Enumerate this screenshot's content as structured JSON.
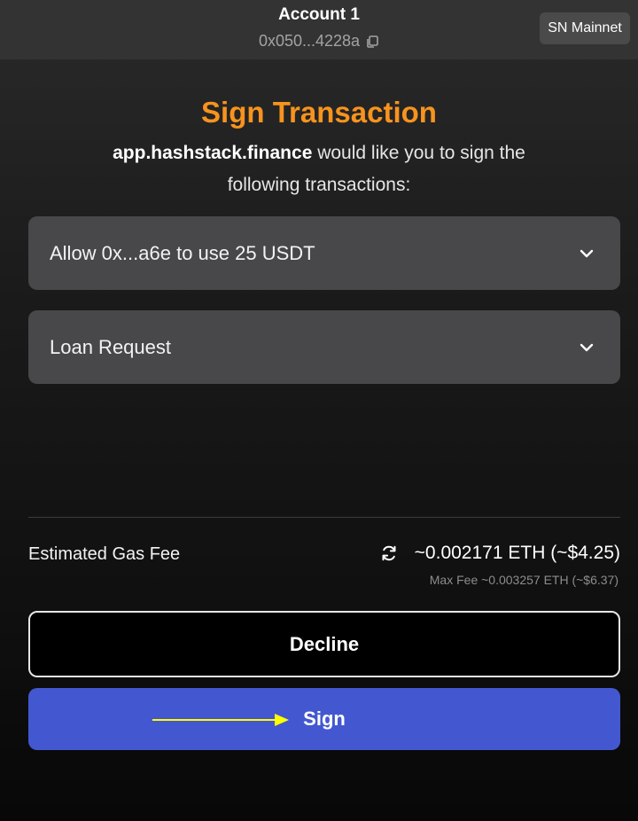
{
  "header": {
    "account_name": "Account 1",
    "account_address": "0x050...4228a",
    "network": "SN Mainnet",
    "copy_icon": "copy-icon"
  },
  "main": {
    "title": "Sign Transaction",
    "dapp_domain": "app.hashstack.finance",
    "subtitle_rest": " would like you to sign the following transactions:",
    "transactions": [
      {
        "label": "Allow 0x...a6e to use 25 USDT",
        "icon": "chevron-down-icon"
      },
      {
        "label": "Loan Request",
        "icon": "chevron-down-icon"
      }
    ]
  },
  "fee": {
    "label": "Estimated Gas Fee",
    "value": "~0.002171 ETH (~$4.25)",
    "max_fee": "Max Fee ~0.003257 ETH (~$6.37)",
    "refresh_icon": "refresh-icon"
  },
  "actions": {
    "decline_label": "Decline",
    "sign_label": "Sign"
  },
  "colors": {
    "title": "#f7931e",
    "sign_button": "#4358d0",
    "card": "#48484b",
    "annotation_arrow": "#ffff00"
  }
}
